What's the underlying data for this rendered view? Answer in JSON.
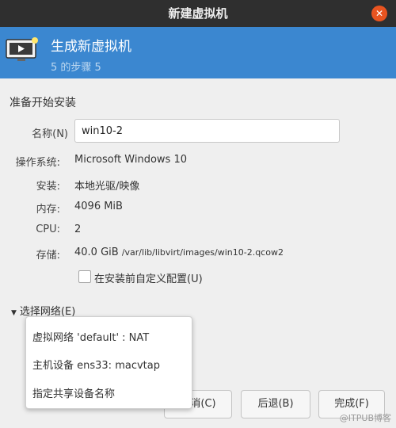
{
  "window": {
    "title": "新建虚拟机",
    "close_glyph": "✕"
  },
  "banner": {
    "title": "生成新虚拟机",
    "step": "5 的步骤 5"
  },
  "section_title": "准备开始安装",
  "name": {
    "label": "名称(N)",
    "value": "win10-2"
  },
  "details": {
    "os_label": "操作系统:",
    "os_value": "Microsoft Windows 10",
    "install_label": "安装:",
    "install_value": "本地光驱/映像",
    "memory_label": "内存:",
    "memory_value": "4096 MiB",
    "cpu_label": "CPU:",
    "cpu_value": "2",
    "storage_label": "存储:",
    "storage_size": "40.0 GiB",
    "storage_path": "/var/lib/libvirt/images/win10-2.qcow2"
  },
  "customize_checkbox": {
    "label": "在安装前自定义配置(U)",
    "checked": false
  },
  "network_expander": {
    "label": "选择网络(E)",
    "arrow": "▼"
  },
  "network_menu": [
    "虚拟网络 'default' : NAT",
    "主机设备 ens33: macvtap",
    "指定共享设备名称"
  ],
  "buttons": {
    "cancel": "取消(C)",
    "back": "后退(B)",
    "finish": "完成(F)"
  },
  "watermark": "@ITPUB博客",
  "colors": {
    "banner": "#3b87d0",
    "titlebar": "#2f2f2f",
    "close": "#e95420"
  }
}
